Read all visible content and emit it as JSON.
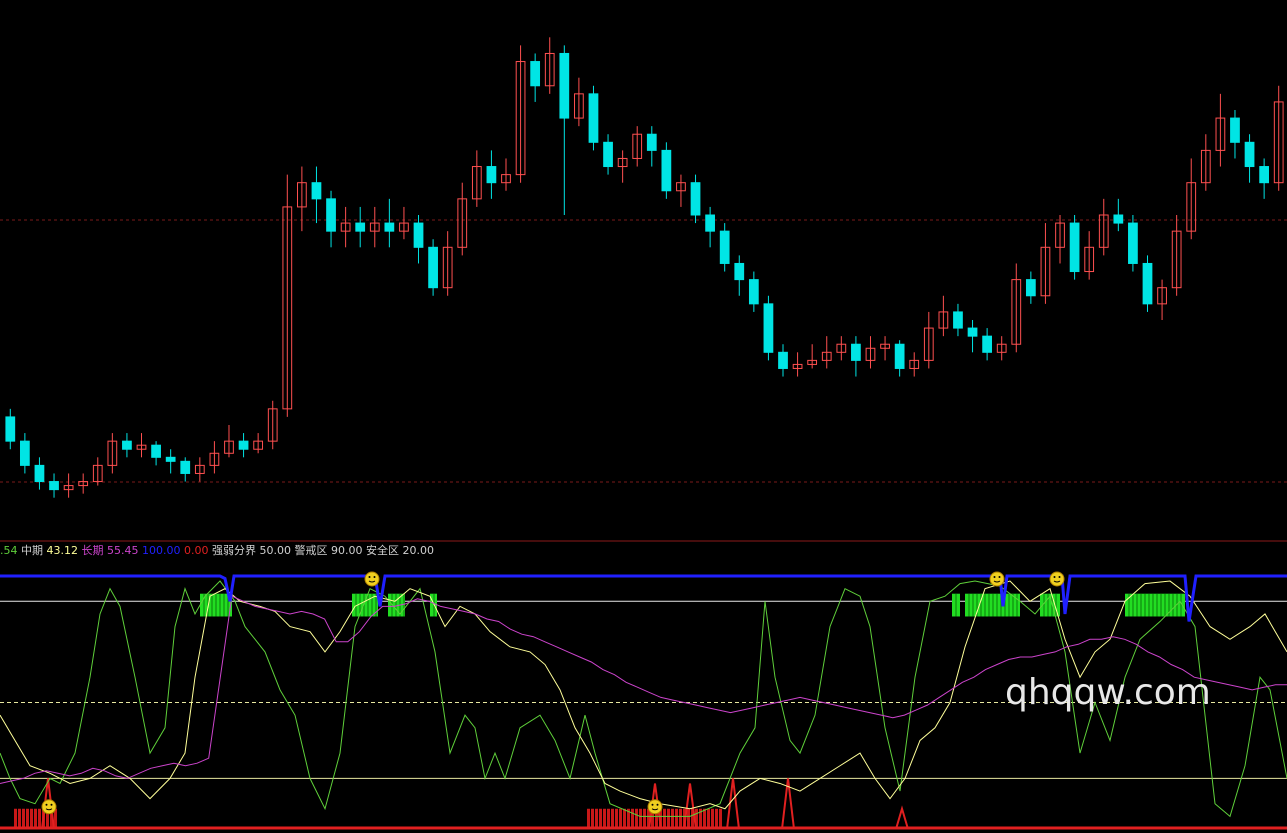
{
  "watermark": "qhqqw.com",
  "legend": {
    "partial_value": ".54",
    "mid_label": "中期",
    "mid_value": "43.12",
    "long_label": "长期",
    "long_value": "55.45",
    "top_value": "100.00",
    "zero_value": "0.00",
    "strong_weak_label": "强弱分界",
    "strong_weak_value": "50.00",
    "warning_label": "警戒区",
    "warning_value": "90.00",
    "safe_label": "安全区",
    "safe_value": "20.00"
  },
  "colors": {
    "up_candle": "#ff5050",
    "down_candle": "#00e5e5",
    "short_line": "#5fcf3a",
    "mid_line": "#ffff99",
    "long_line": "#cc44cc",
    "top_line": "#2020ff",
    "bottom_line": "#e02020",
    "green_bars": "#22dd22",
    "red_bars": "#c81818"
  },
  "chart_data": [
    {
      "type": "candlestick",
      "title": "",
      "series": [
        {
          "name": "",
          "values": [
            [
              11.9,
              11.6,
              12.0,
              11.5
            ],
            [
              11.6,
              11.3,
              11.7,
              11.2
            ],
            [
              11.3,
              11.1,
              11.4,
              11.0
            ],
            [
              11.1,
              11.0,
              11.2,
              10.9
            ],
            [
              11.0,
              11.05,
              11.2,
              10.9
            ],
            [
              11.05,
              11.1,
              11.2,
              10.95
            ],
            [
              11.1,
              11.3,
              11.4,
              11.05
            ],
            [
              11.3,
              11.6,
              11.7,
              11.2
            ],
            [
              11.6,
              11.5,
              11.7,
              11.4
            ],
            [
              11.5,
              11.55,
              11.7,
              11.4
            ],
            [
              11.55,
              11.4,
              11.6,
              11.3
            ],
            [
              11.4,
              11.35,
              11.5,
              11.2
            ],
            [
              11.35,
              11.2,
              11.4,
              11.1
            ],
            [
              11.2,
              11.3,
              11.4,
              11.1
            ],
            [
              11.3,
              11.45,
              11.6,
              11.2
            ],
            [
              11.45,
              11.6,
              11.8,
              11.4
            ],
            [
              11.6,
              11.5,
              11.7,
              11.4
            ],
            [
              11.5,
              11.6,
              11.7,
              11.45
            ],
            [
              11.6,
              12.0,
              12.1,
              11.5
            ],
            [
              12.0,
              14.5,
              14.9,
              11.9
            ],
            [
              14.5,
              14.8,
              15.0,
              14.2
            ],
            [
              14.8,
              14.6,
              15.0,
              14.3
            ],
            [
              14.6,
              14.2,
              14.7,
              14.0
            ],
            [
              14.2,
              14.3,
              14.5,
              14.0
            ],
            [
              14.3,
              14.2,
              14.5,
              14.0
            ],
            [
              14.2,
              14.3,
              14.5,
              14.0
            ],
            [
              14.3,
              14.2,
              14.6,
              14.0
            ],
            [
              14.2,
              14.3,
              14.5,
              14.1
            ],
            [
              14.3,
              14.0,
              14.4,
              13.8
            ],
            [
              14.0,
              13.5,
              14.1,
              13.4
            ],
            [
              13.5,
              14.0,
              14.2,
              13.4
            ],
            [
              14.0,
              14.6,
              14.8,
              13.9
            ],
            [
              14.6,
              15.0,
              15.2,
              14.5
            ],
            [
              15.0,
              14.8,
              15.2,
              14.6
            ],
            [
              14.8,
              14.9,
              15.1,
              14.7
            ],
            [
              14.9,
              16.3,
              16.5,
              14.8
            ],
            [
              16.3,
              16.0,
              16.4,
              15.8
            ],
            [
              16.0,
              16.4,
              16.6,
              15.9
            ],
            [
              16.4,
              15.6,
              16.5,
              14.4
            ],
            [
              15.6,
              15.9,
              16.1,
              15.5
            ],
            [
              15.9,
              15.3,
              16.0,
              15.2
            ],
            [
              15.3,
              15.0,
              15.4,
              14.9
            ],
            [
              15.0,
              15.1,
              15.2,
              14.8
            ],
            [
              15.1,
              15.4,
              15.5,
              15.0
            ],
            [
              15.4,
              15.2,
              15.5,
              15.0
            ],
            [
              15.2,
              14.7,
              15.3,
              14.6
            ],
            [
              14.7,
              14.8,
              14.9,
              14.5
            ],
            [
              14.8,
              14.4,
              14.9,
              14.3
            ],
            [
              14.4,
              14.2,
              14.5,
              14.0
            ],
            [
              14.2,
              13.8,
              14.3,
              13.7
            ],
            [
              13.8,
              13.6,
              13.9,
              13.4
            ],
            [
              13.6,
              13.3,
              13.7,
              13.2
            ],
            [
              13.3,
              12.7,
              13.4,
              12.6
            ],
            [
              12.7,
              12.5,
              12.8,
              12.4
            ],
            [
              12.5,
              12.55,
              12.7,
              12.4
            ],
            [
              12.55,
              12.6,
              12.8,
              12.5
            ],
            [
              12.6,
              12.7,
              12.9,
              12.5
            ],
            [
              12.7,
              12.8,
              12.9,
              12.6
            ],
            [
              12.8,
              12.6,
              12.9,
              12.4
            ],
            [
              12.6,
              12.75,
              12.9,
              12.5
            ],
            [
              12.75,
              12.8,
              12.9,
              12.6
            ],
            [
              12.8,
              12.5,
              12.85,
              12.4
            ],
            [
              12.5,
              12.6,
              12.7,
              12.4
            ],
            [
              12.6,
              13.0,
              13.2,
              12.5
            ],
            [
              13.0,
              13.2,
              13.4,
              12.9
            ],
            [
              13.2,
              13.0,
              13.3,
              12.9
            ],
            [
              13.0,
              12.9,
              13.1,
              12.7
            ],
            [
              12.9,
              12.7,
              13.0,
              12.6
            ],
            [
              12.7,
              12.8,
              12.9,
              12.6
            ],
            [
              12.8,
              13.6,
              13.8,
              12.7
            ],
            [
              13.6,
              13.4,
              13.7,
              13.3
            ],
            [
              13.4,
              14.0,
              14.3,
              13.3
            ],
            [
              14.0,
              14.3,
              14.4,
              13.8
            ],
            [
              14.3,
              13.7,
              14.4,
              13.6
            ],
            [
              13.7,
              14.0,
              14.2,
              13.6
            ],
            [
              14.0,
              14.4,
              14.6,
              13.9
            ],
            [
              14.4,
              14.3,
              14.6,
              14.2
            ],
            [
              14.3,
              13.8,
              14.4,
              13.7
            ],
            [
              13.8,
              13.3,
              13.9,
              13.2
            ],
            [
              13.3,
              13.5,
              13.6,
              13.1
            ],
            [
              13.5,
              14.2,
              14.4,
              13.4
            ],
            [
              14.2,
              14.8,
              15.1,
              14.1
            ],
            [
              14.8,
              15.2,
              15.4,
              14.7
            ],
            [
              15.2,
              15.6,
              15.9,
              15.0
            ],
            [
              15.6,
              15.3,
              15.7,
              15.1
            ],
            [
              15.3,
              15.0,
              15.4,
              14.8
            ],
            [
              15.0,
              14.8,
              15.1,
              14.6
            ],
            [
              14.8,
              15.8,
              16.0,
              14.7
            ]
          ]
        }
      ]
    },
    {
      "type": "line",
      "title": "",
      "ylim": [
        0,
        100
      ],
      "series": [
        {
          "name": "长期",
          "values": [
            18,
            19,
            20,
            22,
            23,
            22,
            21,
            22,
            24,
            23,
            21,
            20,
            22,
            24,
            25,
            26,
            25,
            26,
            28,
            60,
            92,
            90,
            88,
            87,
            86,
            85,
            86,
            85,
            83,
            74,
            74,
            78,
            84,
            88,
            88,
            89,
            91,
            90,
            88,
            87,
            86,
            85,
            83,
            82,
            79,
            77,
            76,
            74,
            72,
            70,
            68,
            66,
            63,
            61,
            58,
            56,
            54,
            52,
            51,
            50,
            49,
            48,
            47,
            46,
            47,
            48,
            49,
            50,
            51,
            52,
            51,
            50,
            49,
            48,
            47,
            46,
            45,
            44,
            45,
            47,
            49,
            52,
            55,
            58,
            60,
            63,
            65,
            67,
            68,
            68,
            69,
            70,
            72,
            73,
            75,
            75,
            76,
            75,
            73,
            70,
            68,
            65,
            63,
            60,
            59,
            58,
            57,
            56,
            55,
            56,
            57,
            57
          ]
        }
      ]
    }
  ]
}
